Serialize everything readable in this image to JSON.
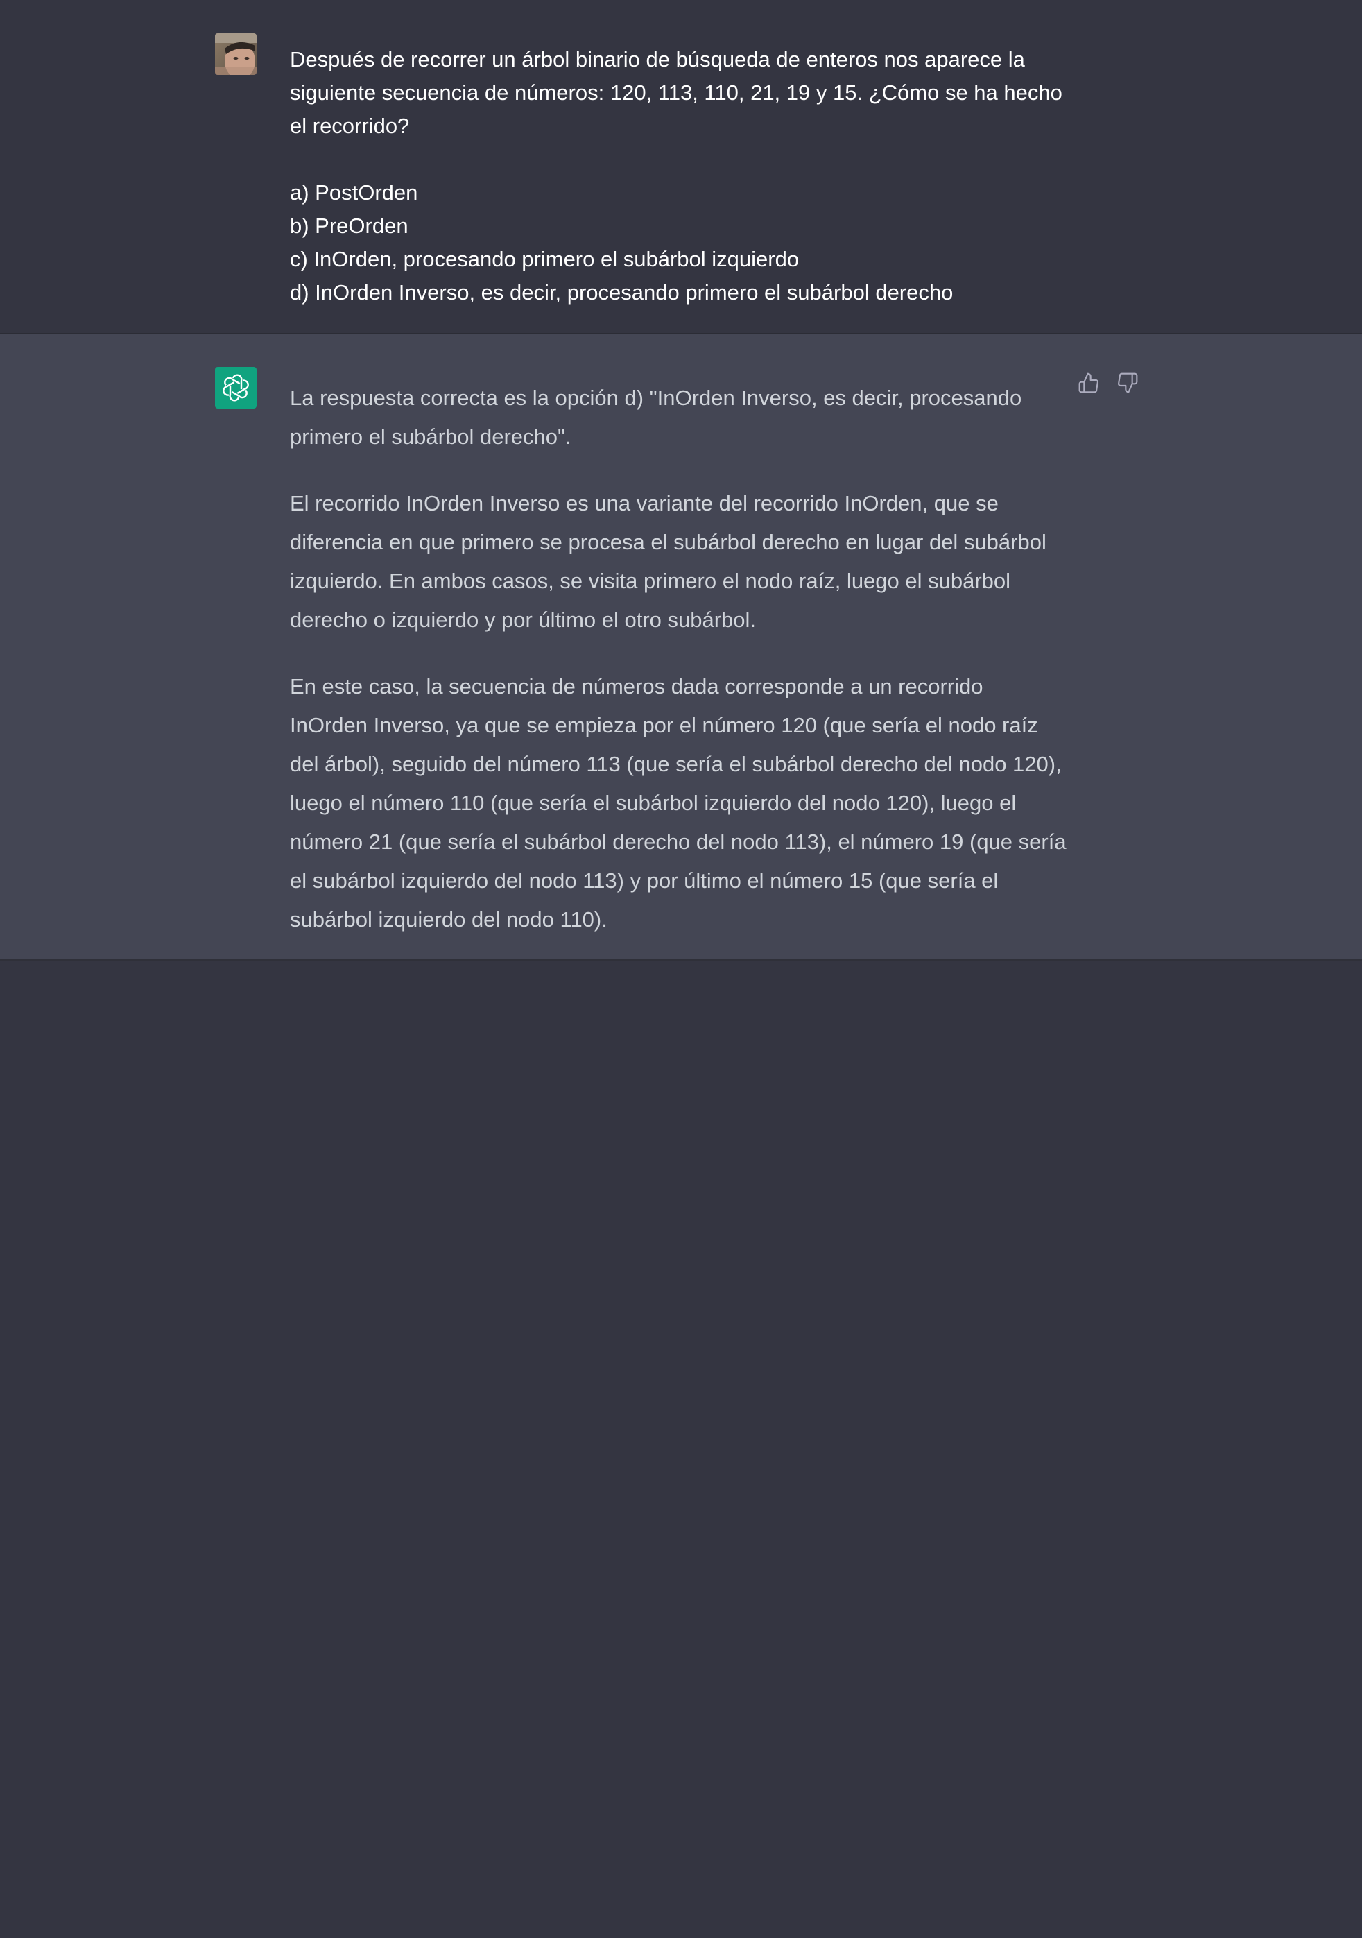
{
  "conversation": {
    "user": {
      "question": "Después de recorrer un árbol binario de búsqueda de enteros nos aparece la siguiente secuencia de números: 120, 113, 110, 21, 19 y 15. ¿Cómo se ha hecho el recorrido?",
      "options": [
        "a) PostOrden",
        "b) PreOrden",
        "c) InOrden, procesando primero el subárbol izquierdo",
        "d) InOrden Inverso, es decir, procesando primero el subárbol derecho"
      ]
    },
    "assistant": {
      "paragraphs": [
        "La respuesta correcta es la opción d) \"InOrden Inverso, es decir, procesando primero el subárbol derecho\".",
        "El recorrido InOrden Inverso es una variante del recorrido InOrden, que se diferencia en que primero se procesa el subárbol derecho en lugar del subárbol izquierdo. En ambos casos, se visita primero el nodo raíz, luego el subárbol derecho o izquierdo y por último el otro subárbol.",
        "En este caso, la secuencia de números dada corresponde a un recorrido InOrden Inverso, ya que se empieza por el número 120 (que sería el nodo raíz del árbol), seguido del número 113 (que sería el subárbol derecho del nodo 120), luego el número 110 (que sería el subárbol izquierdo del nodo 120), luego el número 21 (que sería el subárbol derecho del nodo 113), el número 19 (que sería el subárbol izquierdo del nodo 113) y por último el número 15 (que sería el subárbol izquierdo del nodo 110)."
      ]
    }
  },
  "icons": {
    "user_avatar": "user-avatar-photo",
    "assistant_avatar": "openai-logo-icon",
    "thumbs_up": "thumbs-up-icon",
    "thumbs_down": "thumbs-down-icon"
  },
  "colors": {
    "background": "#343541",
    "assistant_background": "#444654",
    "assistant_avatar": "#10a37f",
    "user_text": "#ffffff",
    "assistant_text": "#d1d5db"
  }
}
